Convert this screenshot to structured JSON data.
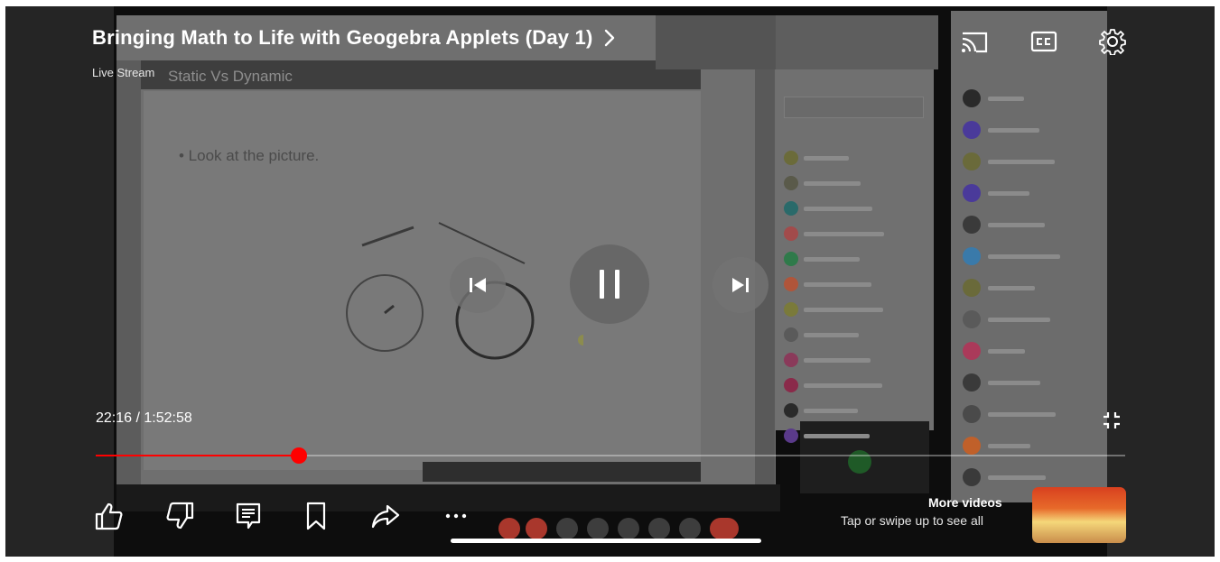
{
  "video": {
    "title": "Bringing Math to Life with Geogebra Applets (Day 1)",
    "subtitle": "Live Stream"
  },
  "slide": {
    "title": "Static Vs Dynamic",
    "bullet": "• Look at the picture."
  },
  "playback": {
    "current_time": "22:16",
    "separator": " / ",
    "duration": "1:52:58",
    "progress_fraction": 0.197
  },
  "top_controls": {
    "cast_icon": "cast-icon",
    "captions_icon": "closed-captions-icon",
    "settings_icon": "gear-icon"
  },
  "center_controls": {
    "previous_icon": "skip-previous-icon",
    "pause_icon": "pause-icon",
    "next_icon": "skip-next-icon"
  },
  "actions": {
    "like_icon": "thumbs-up-icon",
    "dislike_icon": "thumbs-down-icon",
    "comments_icon": "comments-icon",
    "save_icon": "bookmark-icon",
    "share_icon": "share-icon",
    "more_icon": "more-horizontal-icon"
  },
  "more_videos": {
    "title": "More videos",
    "hint": "Tap or swipe up to see all"
  },
  "colors": {
    "accent": "#ff0000",
    "background": "#252525"
  }
}
